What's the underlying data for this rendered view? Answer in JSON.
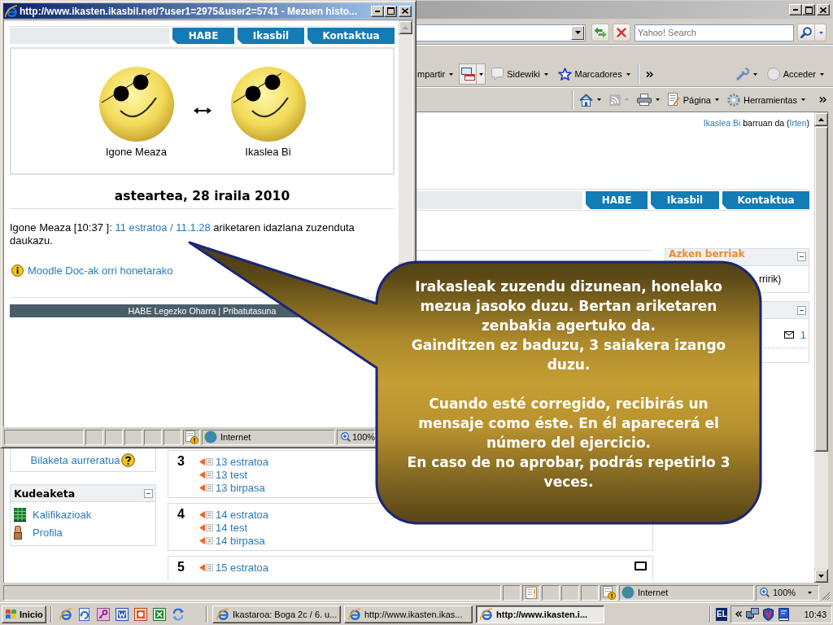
{
  "popup_window": {
    "title": "http://www.ikasten.ikasbil.net/?user1=2975&user2=5741 - Mezuen histo...",
    "nav_tabs": [
      "HABE",
      "Ikasbil",
      "Kontaktua"
    ],
    "participants": [
      "Igone Meaza",
      "Ikaslea Bi"
    ],
    "date_heading": "asteartea, 28 iraila 2010",
    "message": [
      {
        "kind": "text",
        "text": "Igone Meaza [10:37 ]: "
      },
      {
        "kind": "link",
        "text": "11 estratoa / 11.1.28"
      },
      {
        "kind": "text",
        "text": " ariketaren idazlana zuzenduta daukazu."
      }
    ],
    "help_link": "Moodle Doc-ak orri honetarako",
    "footer": "HABE Legezko Oharra | Pribatutasuna",
    "status_bar": {
      "zone": "Internet",
      "zoom": "100%"
    }
  },
  "main_window": {
    "search": {
      "placeholder": "Yahoo! Search"
    },
    "toolbar": [
      "mpartir",
      "Sidewiki",
      "Marcadores",
      "Acceder"
    ],
    "command_bar": [
      "Página",
      "Herramientas"
    ],
    "login_status": [
      {
        "kind": "link",
        "text": "Ikaslea Bi"
      },
      {
        "kind": "text",
        "text": " barruan da ("
      },
      {
        "kind": "link",
        "text": "Irten"
      },
      {
        "kind": "text",
        "text": ")"
      }
    ],
    "nav_tabs": [
      "HABE",
      "Ikasbil",
      "Kontaktua"
    ],
    "search_block": {
      "link": "Bilaketa aurreratua"
    },
    "admin_block": {
      "title": "Kudeaketa",
      "items": [
        {
          "kind": "grades",
          "label": "Kalifikazioak"
        },
        {
          "kind": "profile",
          "label": "Profila"
        }
      ]
    },
    "sections": [
      {
        "number": "3",
        "items": [
          "13 estratoa",
          "13 test",
          "13 birpasa"
        ]
      },
      {
        "number": "4",
        "items": [
          "14 estratoa",
          "14 test",
          "14 birpasa"
        ]
      },
      {
        "number": "5",
        "items": [
          "15 estratoa"
        ]
      }
    ],
    "news_block": {
      "title": "Azken berriak",
      "text": "rririk)"
    },
    "messages_block": {
      "count": "1"
    },
    "status_bar": {
      "zone": "Internet",
      "zoom": "100%"
    }
  },
  "callout": {
    "groups": [
      {
        "paragraphs": [
          {
            "lines": [
              "Irakasleak zuzendu dizunean, honelako",
              "mezua jasoko duzu. Bertan ariketaren",
              "zenbakia agertuko da."
            ]
          },
          {
            "lines": [
              "Gainditzen ez baduzu, 3 saiakera izango",
              "duzu."
            ]
          }
        ]
      },
      {
        "paragraphs": [
          {
            "lines": [
              "Cuando esté corregido, recibirás un",
              "mensaje como éste. En él aparecerá el",
              "número del ejercicio."
            ]
          },
          {
            "lines": [
              "En caso de no aprobar, podrás repetirlo 3",
              "veces."
            ]
          }
        ]
      }
    ]
  },
  "taskbar": {
    "start": "Inicio",
    "tasks": [
      {
        "label": "Ikastaroa: Boga 2c / 6. u...",
        "selected": false
      },
      {
        "label": "http://www.ikasten.ikas...",
        "selected": false
      },
      {
        "label": "http://www.ikasten.i...",
        "selected": true
      }
    ],
    "language": "EL",
    "clock": "10:43"
  }
}
